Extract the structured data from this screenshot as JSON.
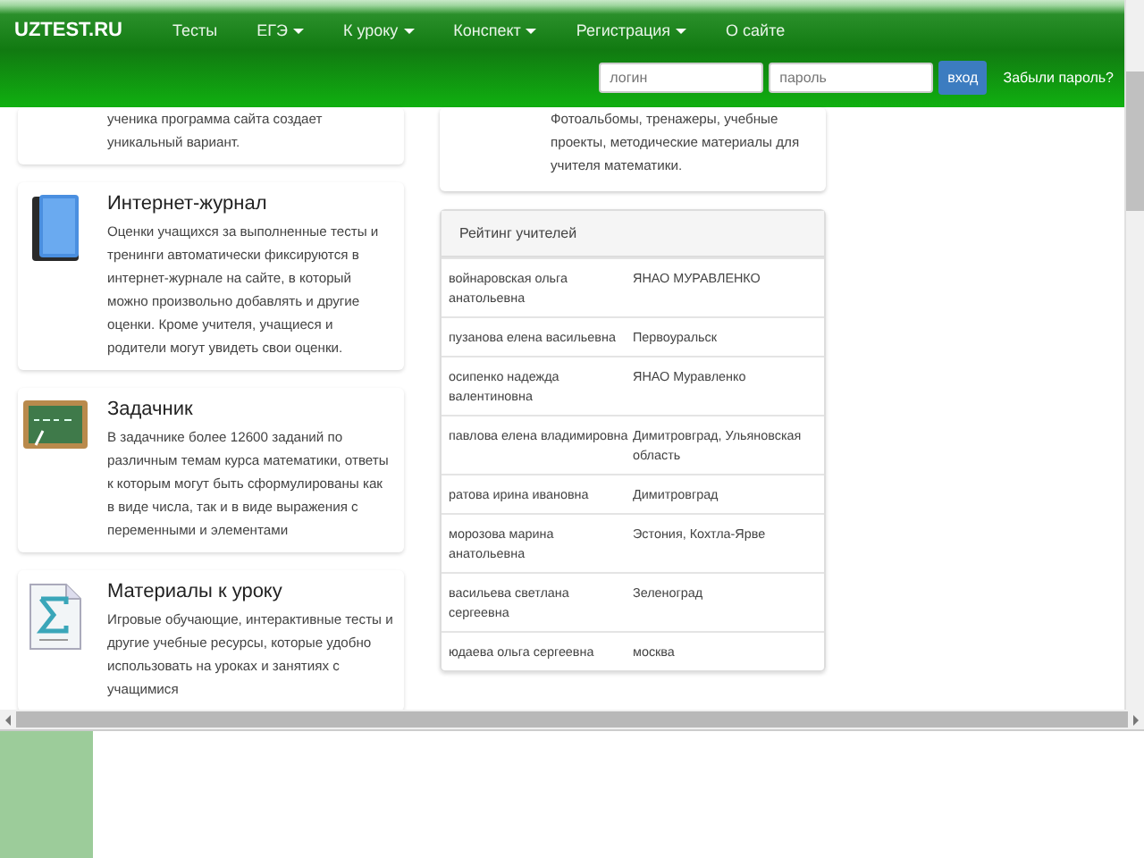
{
  "header": {
    "logo": "UZTEST.RU",
    "nav": [
      {
        "label": "Тесты",
        "dropdown": false
      },
      {
        "label": "ЕГЭ",
        "dropdown": true
      },
      {
        "label": "К уроку",
        "dropdown": true
      },
      {
        "label": "Конспект",
        "dropdown": true
      },
      {
        "label": "Регистрация",
        "dropdown": true
      },
      {
        "label": "О сайте",
        "dropdown": false
      }
    ],
    "login": {
      "placeholder": "логин"
    },
    "password": {
      "placeholder": "пароль"
    },
    "submit": "вход",
    "forgot": "Забыли пароль?"
  },
  "features": [
    {
      "kind": "plain",
      "text": "ученика программа сайта создает уникальный вариант."
    },
    {
      "kind": "book",
      "title": "Интернет-журнал",
      "text": "Оценки учащихся за выполненные тесты и тренинги автоматически фиксируются в интернет-журнале на сайте, в который можно произвольно добавлять и другие оценки. Кроме учителя, учащиеся и родители могут увидеть свои оценки."
    },
    {
      "kind": "chalkboard",
      "title": "Задачник",
      "text": "В задачнике более 12600 заданий по различным темам курса математики, ответы к которым могут быть сформулированы как в виде числа, так и в виде выражения с переменными и элементами"
    },
    {
      "kind": "sigma",
      "title": "Материалы к уроку",
      "text": "Игровые обучающие, интерактивные тесты и другие учебные ресурсы, которые удобно использовать на уроках и занятиях с учащимися"
    }
  ],
  "info": {
    "text": "Фотоальбомы, тренажеры, учебные проекты, методические материалы для учителя математики."
  },
  "rating": {
    "title": "Рейтинг учителей",
    "rows": [
      {
        "name": "войнаровская ольга анатольевна",
        "place": "ЯНАО МУРАВЛЕНКО"
      },
      {
        "name": "пузанова елена васильевна",
        "place": "Первоуральск"
      },
      {
        "name": "осипенко надежда валентиновна",
        "place": "ЯНАО Муравленко"
      },
      {
        "name": "павлова елена владимировна",
        "place": "Димитровград, Ульяновская область"
      },
      {
        "name": "ратова ирина ивановна",
        "place": "Димитровград"
      },
      {
        "name": "морозова марина анатольевна",
        "place": "Эстония, Кохтла-Ярве"
      },
      {
        "name": "васильева светлана сергеевна",
        "place": "Зеленоград"
      },
      {
        "name": "юдаева ольга сергеевна",
        "place": "москва"
      }
    ]
  }
}
